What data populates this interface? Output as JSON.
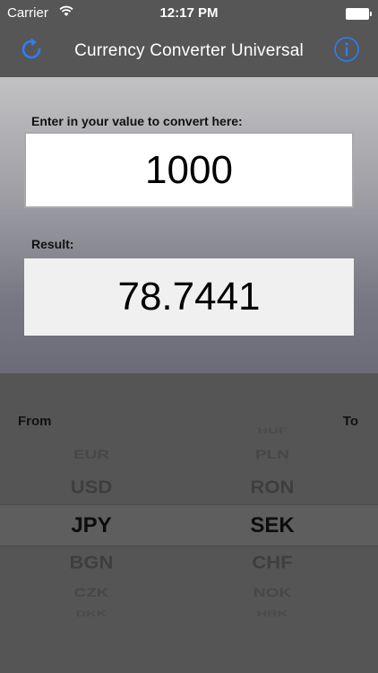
{
  "status": {
    "carrier": "Carrier",
    "time": "12:17 PM"
  },
  "nav": {
    "title": "Currency Converter Universal",
    "refresh_icon": "refresh-icon",
    "info_icon": "info-icon"
  },
  "input": {
    "label": "Enter in your value to convert here:",
    "value": "1000"
  },
  "result": {
    "label": "Result:",
    "value": "78.7441"
  },
  "picker": {
    "from_label": "From",
    "to_label": "To",
    "from_items": [
      "EUR",
      "USD",
      "JPY",
      "BGN",
      "CZK",
      "DKK"
    ],
    "to_items": [
      "HUF",
      "PLN",
      "RON",
      "SEK",
      "CHF",
      "NOK",
      "HRK"
    ],
    "from_selected": "JPY",
    "to_selected": "SEK"
  },
  "colors": {
    "accent": "#2f7df6"
  }
}
